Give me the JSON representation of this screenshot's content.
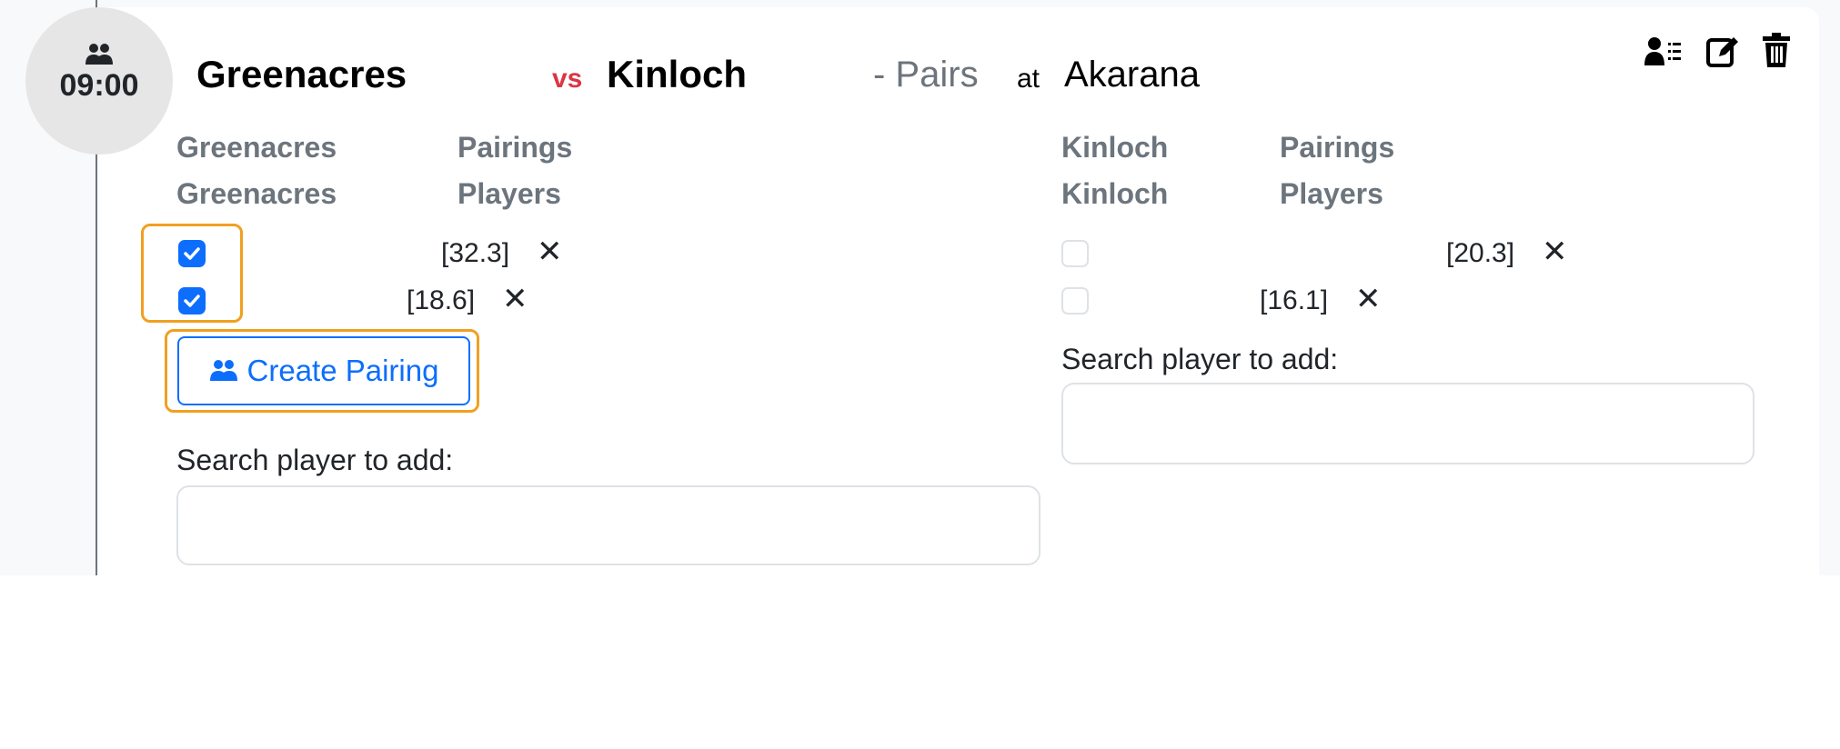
{
  "match": {
    "time": "09:00",
    "home_team": "Greenacres",
    "vs": "vs",
    "away_team": "Kinloch",
    "format": "- Pairs",
    "at": "at",
    "venue": "Akarana"
  },
  "home": {
    "team_header_1": "Greenacres",
    "pairings_header": "Pairings",
    "team_header_2": "Greenacres",
    "players_header": "Players",
    "players": [
      {
        "rating": "[32.3]",
        "checked": true
      },
      {
        "rating": "[18.6]",
        "checked": true
      }
    ],
    "create_pairing_label": "Create Pairing",
    "search_label": "Search player to add:",
    "search_value": ""
  },
  "away": {
    "team_header_1": "Kinloch",
    "pairings_header": "Pairings",
    "team_header_2": "Kinloch",
    "players_header": "Players",
    "players": [
      {
        "rating": "[20.3]",
        "checked": false
      },
      {
        "rating": "[16.1]",
        "checked": false
      }
    ],
    "search_label": "Search player to add:",
    "search_value": ""
  },
  "remove_symbol": "✕",
  "icons": {
    "badge": "users-icon",
    "assign": "user-list-icon",
    "edit": "edit-icon",
    "delete": "trash-icon",
    "button": "users-icon"
  },
  "colors": {
    "accent": "#0d6efd",
    "vs": "#dc3545",
    "highlight": "#f0a020",
    "muted": "#6c757d"
  }
}
